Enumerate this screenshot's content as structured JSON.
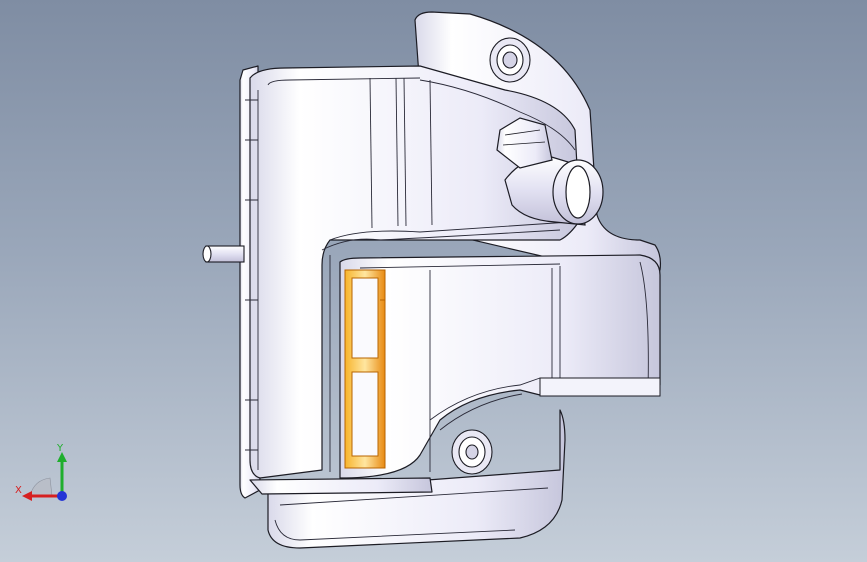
{
  "viewport": {
    "model": "housing-part-isometric-view",
    "triad": {
      "x_label": "X",
      "y_label": "Y",
      "x_color": "#d62020",
      "y_color": "#1fae2d",
      "z_color": "#2434d6"
    },
    "colors": {
      "background_top": "#7f8da3",
      "background_bottom": "#c5ced9",
      "part_fill": "#f4f4fb",
      "part_edge": "#1c1c24",
      "highlight_orange": "#f3a21b"
    }
  }
}
